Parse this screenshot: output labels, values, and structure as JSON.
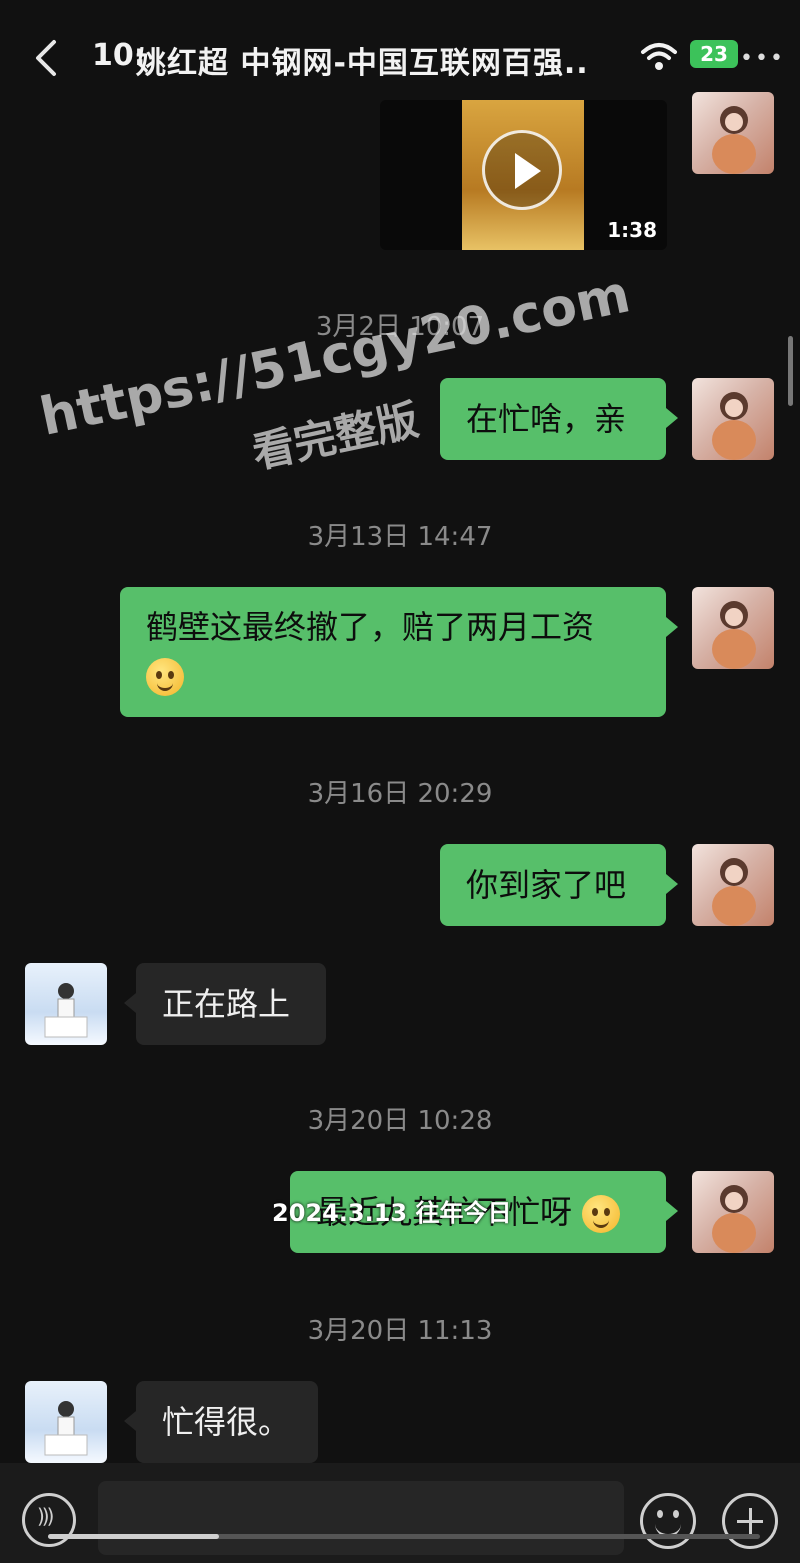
{
  "status_bar": {
    "time": "10:",
    "battery": "23"
  },
  "header": {
    "title": "姚红超 中钢网-中国互联网百强..",
    "menu": "•••"
  },
  "video": {
    "duration": "1:38"
  },
  "messages": [
    {
      "timestamp": "3月2日 10:07",
      "from": "me",
      "text": "在忙啥，亲"
    },
    {
      "timestamp": "3月13日 14:47",
      "from": "me",
      "text": "鹤壁这最终撤了，赔了两月工资"
    },
    {
      "timestamp": "3月16日 20:29",
      "from": "me",
      "text": "你到家了吧"
    },
    {
      "from": "other",
      "text": "正在路上"
    },
    {
      "timestamp": "3月20日 10:28",
      "from": "me",
      "text": "最近九其忙不忙呀"
    },
    {
      "timestamp": "3月20日 11:13",
      "from": "other",
      "text": "忙得很。"
    }
  ],
  "overlay_caption": "2024.3.13 往年今日",
  "watermark": {
    "url": "https://51cgy20.com",
    "caption": "看完整版"
  },
  "video_progress": 0.24
}
